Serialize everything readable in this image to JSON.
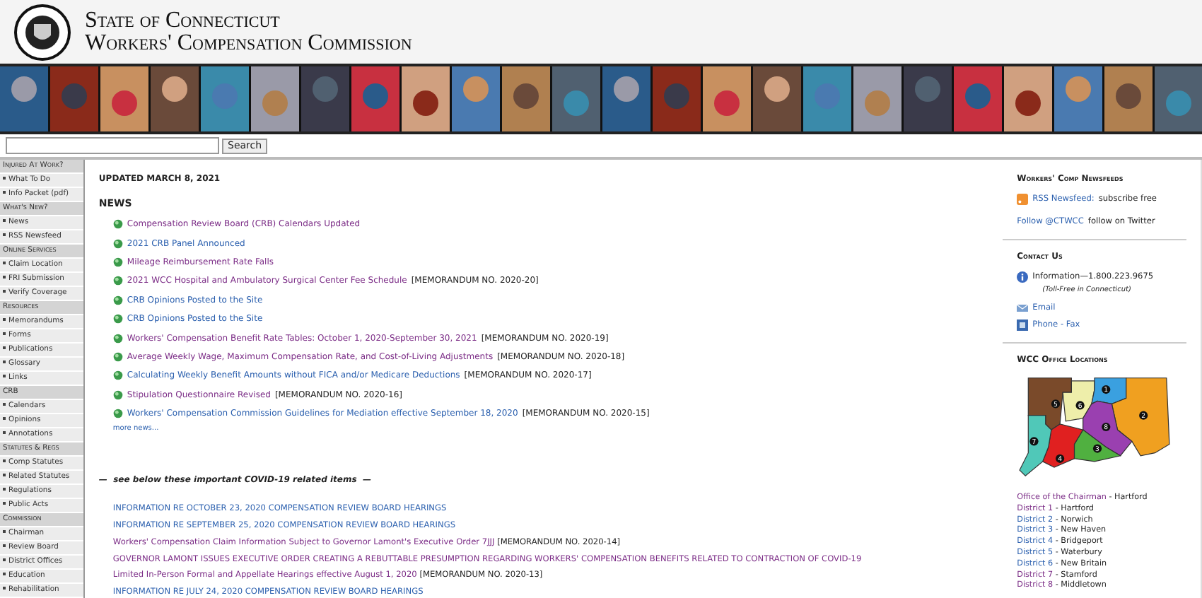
{
  "header": {
    "title_line_1": "State of Connecticut",
    "title_line_2": "Workers' Compensation Commission"
  },
  "search": {
    "button": "Search"
  },
  "sidebar": [
    {
      "kind": "heading",
      "label": "Injured At Work?"
    },
    {
      "kind": "item",
      "label": "What To Do"
    },
    {
      "kind": "item",
      "label": "Info Packet (pdf)"
    },
    {
      "kind": "heading",
      "label": "What's New?"
    },
    {
      "kind": "item",
      "label": "News"
    },
    {
      "kind": "item",
      "label": "RSS Newsfeed"
    },
    {
      "kind": "heading",
      "label": "Online Services"
    },
    {
      "kind": "item",
      "label": "Claim Location"
    },
    {
      "kind": "item",
      "label": "FRI Submission"
    },
    {
      "kind": "item",
      "label": "Verify Coverage"
    },
    {
      "kind": "heading",
      "label": "Resources"
    },
    {
      "kind": "item",
      "label": "Memorandums"
    },
    {
      "kind": "item",
      "label": "Forms"
    },
    {
      "kind": "item",
      "label": "Publications"
    },
    {
      "kind": "item",
      "label": "Glossary"
    },
    {
      "kind": "item",
      "label": "Links"
    },
    {
      "kind": "heading",
      "label": "CRB"
    },
    {
      "kind": "item",
      "label": "Calendars"
    },
    {
      "kind": "item",
      "label": "Opinions"
    },
    {
      "kind": "item",
      "label": "Annotations"
    },
    {
      "kind": "heading",
      "label": "Statutes & Regs"
    },
    {
      "kind": "item",
      "label": "Comp Statutes"
    },
    {
      "kind": "item",
      "label": "Related Statutes"
    },
    {
      "kind": "item",
      "label": "Regulations"
    },
    {
      "kind": "item",
      "label": "Public Acts"
    },
    {
      "kind": "heading",
      "label": "Commission"
    },
    {
      "kind": "item",
      "label": "Chairman"
    },
    {
      "kind": "item",
      "label": "Review Board"
    },
    {
      "kind": "item",
      "label": "District Offices"
    },
    {
      "kind": "item",
      "label": "Education"
    },
    {
      "kind": "item",
      "label": "Rehabilitation"
    }
  ],
  "main": {
    "updated": "UPDATED MARCH 8, 2021",
    "news_heading": "NEWS",
    "news": [
      {
        "link": "Compensation Review Board (CRB) Calendars Updated",
        "visited": true
      },
      {
        "link": "2021 CRB Panel Announced",
        "visited": false
      },
      {
        "link": "Mileage Reimbursement Rate Falls",
        "visited": true
      },
      {
        "link": "2021 WCC Hospital and Ambulatory Surgical Center Fee Schedule",
        "note": "[MEMORANDUM NO. 2020-20]",
        "visited": true
      },
      {
        "link": "CRB Opinions Posted to the Site",
        "visited": false
      },
      {
        "link": "CRB Opinions Posted to the Site",
        "visited": false
      },
      {
        "link": "Workers' Compensation Benefit Rate Tables: October 1, 2020-September 30, 2021",
        "note": "[MEMORANDUM NO. 2020-19]",
        "visited": true
      },
      {
        "link": "Average Weekly Wage, Maximum Compensation Rate, and Cost-of-Living Adjustments",
        "note": "[MEMORANDUM NO. 2020-18]",
        "visited": true
      },
      {
        "link": "Calculating Weekly Benefit Amounts without FICA and/or Medicare Deductions",
        "note": "[MEMORANDUM NO. 2020-17]",
        "visited": false
      },
      {
        "link": "Stipulation Questionnaire Revised",
        "note": "[MEMORANDUM NO. 2020-16]",
        "visited": true
      },
      {
        "link": "Workers' Compensation Commission Guidelines for Mediation effective September 18, 2020",
        "note": "[MEMORANDUM NO. 2020-15]",
        "visited": false
      }
    ],
    "more_news": "more news...",
    "covid_heading": "—  see below these important COVID-19 related items  —",
    "covid": [
      {
        "link": "INFORMATION RE OCTOBER 23, 2020 COMPENSATION REVIEW BOARD HEARINGS",
        "visited": false
      },
      {
        "link": "INFORMATION RE SEPTEMBER 25, 2020 COMPENSATION REVIEW BOARD HEARINGS",
        "visited": false
      },
      {
        "link": "Workers' Compensation Claim Information Subject to Governor Lamont's Executive Order 7JJJ",
        "note": "[MEMORANDUM NO. 2020-14]",
        "visited": true
      },
      {
        "link": "GOVERNOR LAMONT ISSUES EXECUTIVE ORDER CREATING A REBUTTABLE PRESUMPTION REGARDING WORKERS' COMPENSATION BENEFITS RELATED TO CONTRACTION OF COVID-19",
        "visited": true
      },
      {
        "link": "Limited In-Person Formal and Appellate Hearings effective August 1, 2020",
        "note": "[MEMORANDUM NO. 2020-13]",
        "visited": true
      },
      {
        "link": "INFORMATION RE JULY 24, 2020 COMPENSATION REVIEW BOARD HEARINGS",
        "visited": false
      }
    ]
  },
  "right": {
    "newsfeeds_heading": "Workers' Comp Newsfeeds",
    "rss": {
      "link": "RSS Newsfeed:",
      "text": "subscribe free"
    },
    "twitter": {
      "link": "Follow @CTWCC",
      "text": "follow on Twitter"
    },
    "contact_heading": "Contact Us",
    "information": "Information—1.800.223.9675",
    "toll_free": "(Toll-Free in Connecticut)",
    "email": "Email",
    "phone": "Phone - Fax",
    "locations_heading": "WCC Office Locations",
    "map": [
      {
        "label": "5",
        "color": "#7a4a2a"
      },
      {
        "label": "6",
        "color": "#eeeeaa"
      },
      {
        "label": "1",
        "color": "#3aa0e0"
      },
      {
        "label": "2",
        "color": "#f0a020"
      },
      {
        "label": "8",
        "color": "#9a40b0"
      },
      {
        "label": "3",
        "color": "#50b040"
      },
      {
        "label": "4",
        "color": "#e02020"
      },
      {
        "label": "7",
        "color": "#50c8b8"
      }
    ],
    "offices": [
      {
        "link": "Office of the Chairman",
        "city": "- Hartford",
        "visited": true
      },
      {
        "link": "District 1",
        "city": "- Hartford",
        "visited": true
      },
      {
        "link": "District 2",
        "city": "- Norwich",
        "visited": false
      },
      {
        "link": "District 3",
        "city": "- New Haven",
        "visited": false
      },
      {
        "link": "District 4",
        "city": "- Bridgeport",
        "visited": false
      },
      {
        "link": "District 5",
        "city": "- Waterbury",
        "visited": false
      },
      {
        "link": "District 6",
        "city": "- New Britain",
        "visited": false
      },
      {
        "link": "District 7",
        "city": "- Stamford",
        "visited": true
      },
      {
        "link": "District 8",
        "city": "- Middletown",
        "visited": true
      }
    ]
  }
}
